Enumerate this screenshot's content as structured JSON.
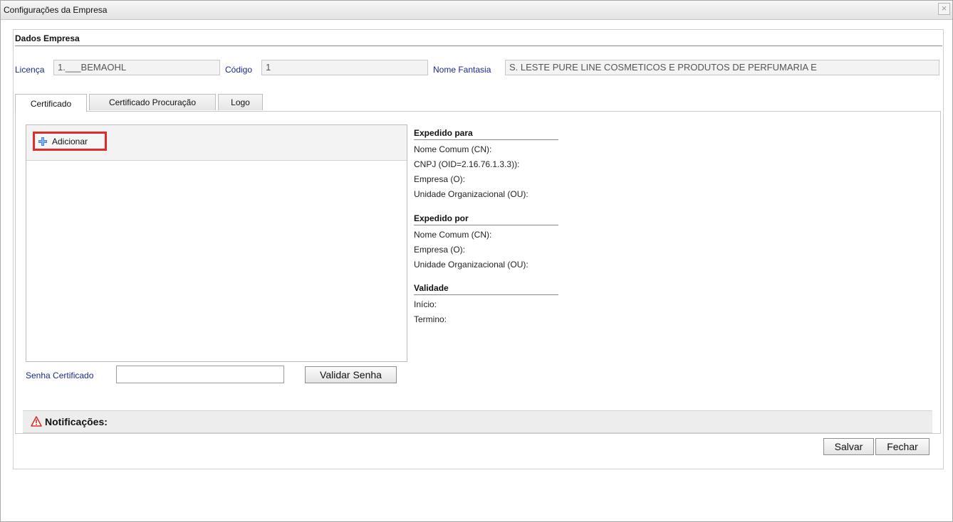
{
  "window": {
    "title": "Configurações da Empresa",
    "close_glyph": "×"
  },
  "dados_empresa": {
    "heading": "Dados Empresa",
    "licenca_label": "Licença",
    "licenca_value": "1.___BEMAOHL",
    "codigo_label": "Código",
    "codigo_value": "1",
    "nome_fantasia_label": "Nome Fantasia",
    "nome_fantasia_value": "S. LESTE PURE LINE COSMETICOS E PRODUTOS DE PERFUMARIA E"
  },
  "tabs": [
    {
      "label": "Certificado",
      "active": true
    },
    {
      "label": "Certificado Procuração",
      "active": false
    },
    {
      "label": "Logo",
      "active": false
    }
  ],
  "certificado": {
    "add_button_label": "Adicionar",
    "add_icon": "plus-icon",
    "senha_label": "Senha Certificado",
    "senha_value": "",
    "validar_button_label": "Validar Senha"
  },
  "info": {
    "expedido_para": {
      "heading": "Expedido para",
      "lines": [
        "Nome Comum (CN):",
        "CNPJ (OID=2.16.76.1.3.3)):",
        "Empresa (O):",
        "Unidade Organizacional (OU):"
      ]
    },
    "expedido_por": {
      "heading": "Expedido por",
      "lines": [
        "Nome Comum (CN):",
        "Empresa (O):",
        "Unidade Organizacional (OU):"
      ]
    },
    "validade": {
      "heading": "Validade",
      "lines": [
        "Início:",
        "Termino:"
      ]
    }
  },
  "notifications": {
    "label": "Notificações:",
    "icon": "warning-icon",
    "icon_color": "#d9302b"
  },
  "footer": {
    "salvar_label": "Salvar",
    "fechar_label": "Fechar"
  },
  "colors": {
    "highlight_border": "#e02b2b",
    "label_blue": "#1a2a8a",
    "plus_blue": "#3a7fd1"
  }
}
